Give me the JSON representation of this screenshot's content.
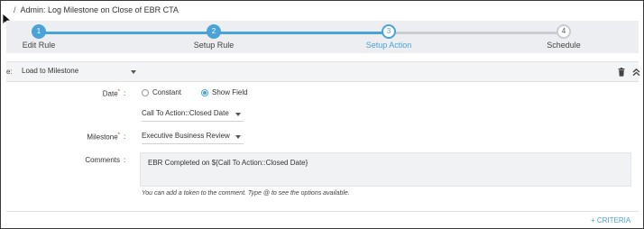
{
  "breadcrumb": {
    "separator": "/",
    "title": "Admin: Log Milestone on Close of EBR CTA"
  },
  "stepper": {
    "steps": [
      {
        "number": "1",
        "label": "Edit Rule",
        "state": "done"
      },
      {
        "number": "2",
        "label": "Setup Rule",
        "state": "done"
      },
      {
        "number": "3",
        "label": "Setup Action",
        "state": "active"
      },
      {
        "number": "4",
        "label": "Schedule",
        "state": "todo"
      }
    ]
  },
  "action": {
    "type_label_fragment": "e:",
    "type_value": "Load to Milestone",
    "icons": {
      "delete": "trash-icon",
      "collapse": "chevron-up-double-icon"
    }
  },
  "form": {
    "date": {
      "label": "Date",
      "required": "*",
      "colon": ":",
      "options": [
        "Constant",
        "Show Field"
      ],
      "selected": "Show Field",
      "field_value": "Call To Action::Closed Date"
    },
    "milestone": {
      "label": "Milestone",
      "required": "*",
      "colon": ":",
      "value": "Executive Business Review"
    },
    "comments": {
      "label": "Comments",
      "colon": ":",
      "value": "EBR Completed on ${Call To Action::Closed Date}",
      "hint": "You can add a token to the comment. Type @ to see the options available."
    }
  },
  "footer": {
    "criteria_label": "+ CRITERIA"
  },
  "colors": {
    "accent": "#4aa3d8",
    "stepper_bg": "#eceef2",
    "required": "#c0392b"
  }
}
